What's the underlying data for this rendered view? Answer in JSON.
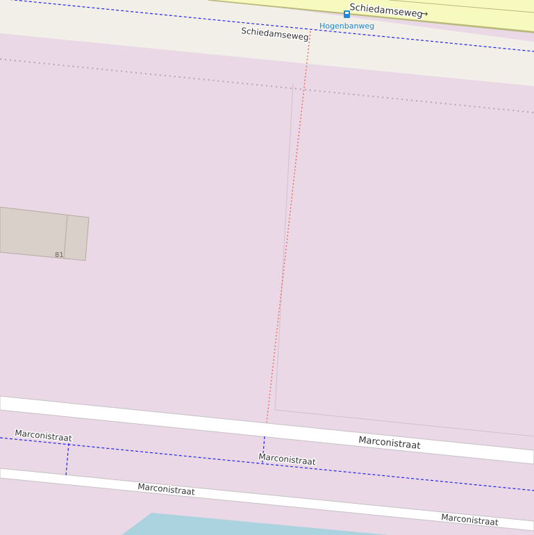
{
  "map": {
    "colors": {
      "landuse": "#ead8e6",
      "road_area": "#f2efe9",
      "primary_road": "#f7fabf",
      "primary_casing": "#b9b97a",
      "street": "#ffffff",
      "street_casing": "#c5c0c3",
      "bus_route": "#2222ee",
      "boundary_dotted": "#b0a8aa",
      "red_path": "#f36b58",
      "building": "#d9d0c9",
      "building_outline": "#b7a9a1",
      "water": "#aad3df",
      "bus_stop": "#1a8ad9"
    },
    "roads": {
      "schiedamseweg_primary": "Schiedamseweg",
      "oneway_arrow": "→",
      "schiedamseweg_service": "Schiedamseweg",
      "marconistraat_upper_right": "Marconistraat",
      "marconistraat_upper_left": "Marconistraat",
      "marconistraat_middle": "Marconistraat",
      "marconistraat_lower_left": "Marconistraat",
      "marconistraat_lower_right": "Marconistraat"
    },
    "bus_stop": {
      "name": "Hogenbanweg",
      "icon": "bus-stop-icon"
    },
    "building": {
      "housenumber": "81"
    }
  }
}
